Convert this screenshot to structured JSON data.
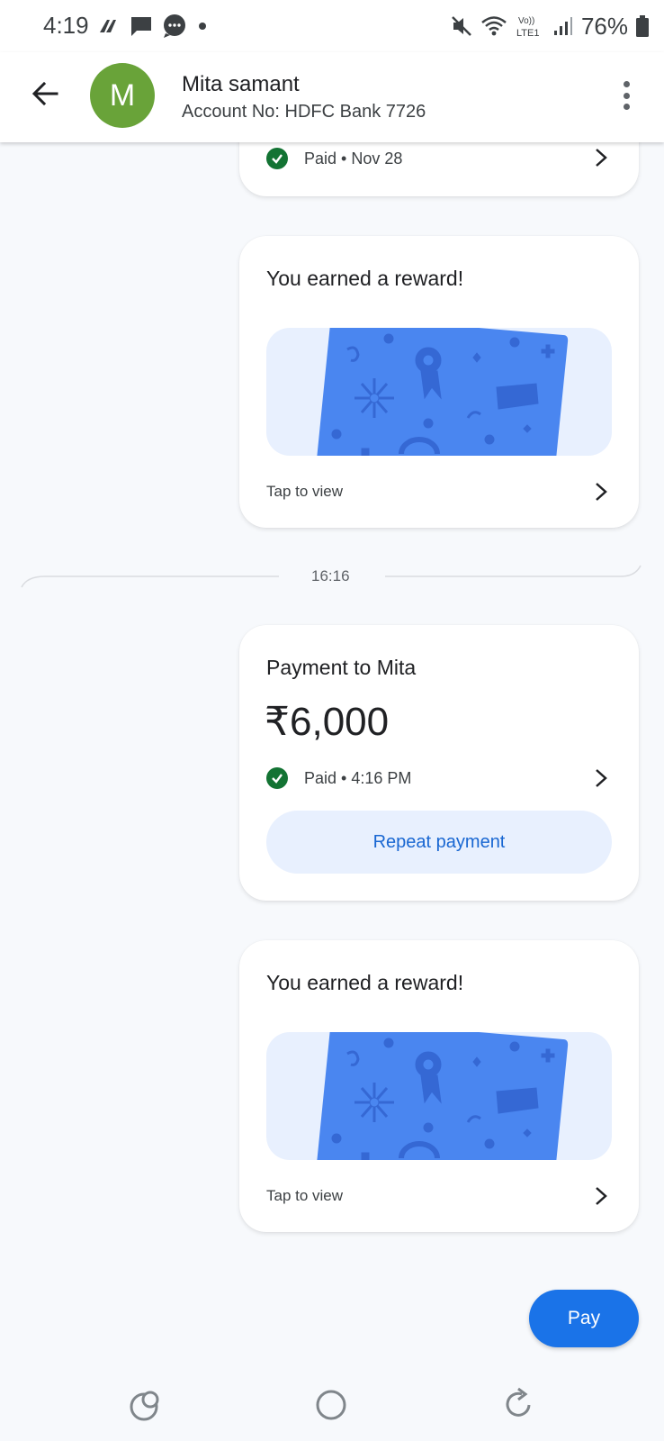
{
  "status_bar": {
    "time": "4:19",
    "battery_percent": "76%",
    "icons": [
      "app-notification-icon",
      "message-icon",
      "chat-bubble-icon",
      "dot-icon",
      "mute-icon",
      "wifi-icon",
      "volte-lte-icon",
      "signal-icon",
      "battery-icon"
    ]
  },
  "header": {
    "avatar_letter": "M",
    "avatar_color": "#69a339",
    "name": "Mita samant",
    "account": "Account No: HDFC Bank 7726"
  },
  "messages": [
    {
      "type": "payment-partial",
      "status": "Paid • Nov 28"
    },
    {
      "type": "reward",
      "title": "You earned a reward!",
      "action": "Tap to view"
    },
    {
      "type": "divider",
      "time": "16:16"
    },
    {
      "type": "payment",
      "title": "Payment to Mita",
      "amount": "₹6,000",
      "status": "Paid • 4:16 PM",
      "repeat_label": "Repeat payment"
    },
    {
      "type": "reward",
      "title": "You earned a reward!",
      "action": "Tap to view"
    }
  ],
  "pay_button": {
    "label": "Pay"
  },
  "colors": {
    "accent": "#1a73e8",
    "paid_green": "#137333",
    "reward_card": "#4a86f0",
    "reward_bg": "#e8f0fe"
  }
}
